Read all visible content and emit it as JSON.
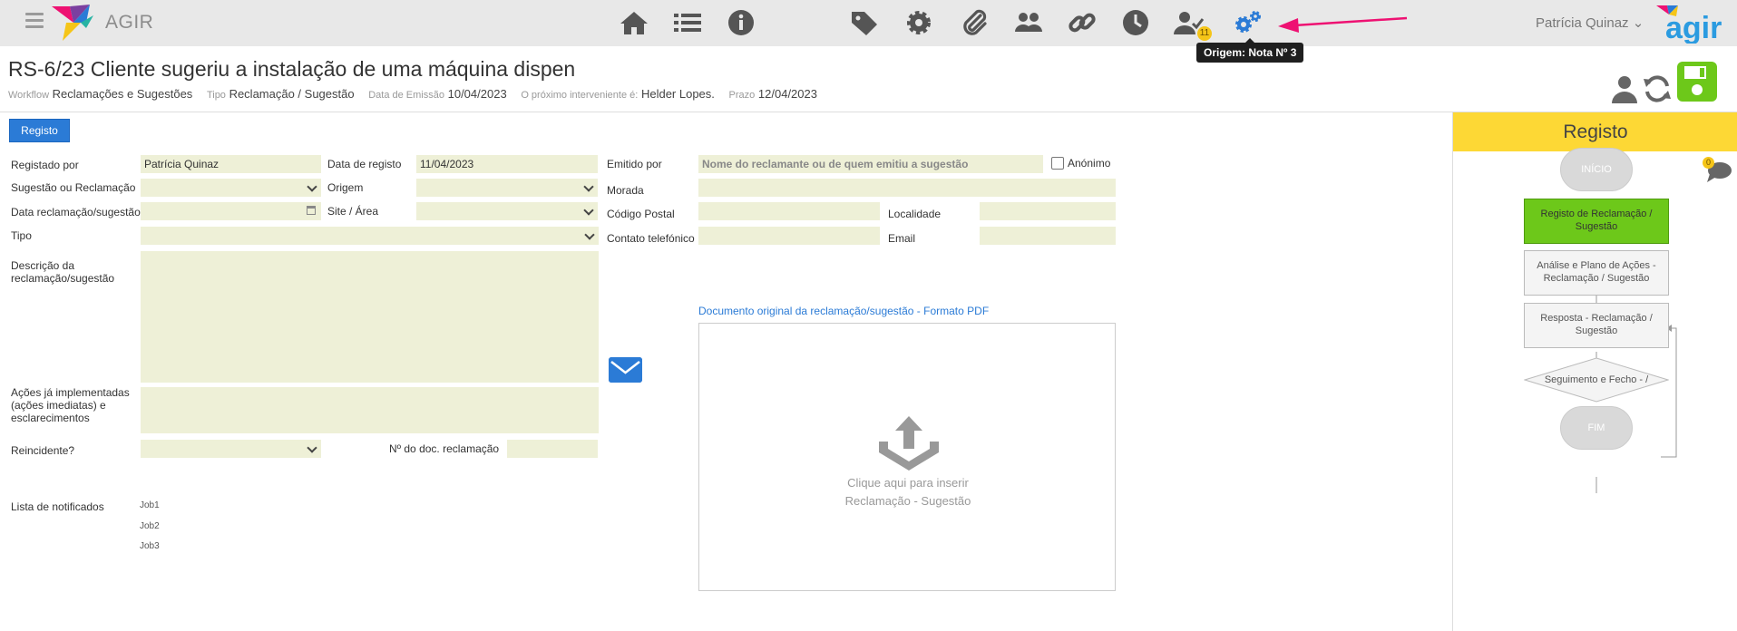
{
  "app": {
    "name": "AGIR",
    "brand_right": "agir"
  },
  "toolbar": {
    "icons": [
      "home-icon",
      "list-icon",
      "info-icon",
      "tags-icon",
      "gear-icon",
      "paperclip-icon",
      "users-icon",
      "link-icon",
      "clock-icon",
      "user-check-icon",
      "gears-icon"
    ],
    "badge": "11",
    "tooltip": "Origem: Nota Nº 3",
    "active_color": "#2b7bd6",
    "arrow_color": "#ee1172"
  },
  "user": {
    "name": "Patrícia Quinaz"
  },
  "header": {
    "title": "RS-6/23 Cliente sugeriu a instalação de uma máquina dispen",
    "meta": [
      {
        "key": "Workflow",
        "value": "Reclamações e Sugestões"
      },
      {
        "key": "Tipo",
        "value": "Reclamação / Sugestão"
      },
      {
        "key": "Data de Emissão",
        "value": "10/04/2023"
      },
      {
        "key": "O próximo interveniente é:",
        "value": "Helder Lopes."
      },
      {
        "key": "Prazo",
        "value": "12/04/2023"
      }
    ]
  },
  "tab": {
    "label": "Registo"
  },
  "form": {
    "registado_por": {
      "label": "Registado por",
      "value": "Patrícia Quinaz"
    },
    "data_registo": {
      "label": "Data de registo",
      "value": "11/04/2023"
    },
    "emitido_por": {
      "label": "Emitido por",
      "placeholder": "Nome do reclamante ou de quem emitiu a sugestão"
    },
    "anonimo": {
      "label": "Anónimo"
    },
    "sugestao_reclamacao": {
      "label": "Sugestão ou Reclamação"
    },
    "origem": {
      "label": "Origem"
    },
    "morada": {
      "label": "Morada"
    },
    "data_reclamacao": {
      "label": "Data reclamação/sugestão"
    },
    "site_area": {
      "label": "Site / Área"
    },
    "codigo_postal": {
      "label": "Código Postal"
    },
    "localidade": {
      "label": "Localidade"
    },
    "tipo": {
      "label": "Tipo"
    },
    "contato": {
      "label": "Contato telefónico"
    },
    "email": {
      "label": "Email"
    },
    "descricao": {
      "label": "Descrição da reclamação/sugestão"
    },
    "acoes": {
      "label": "Ações já implementadas (ações imediatas) e esclarecimentos"
    },
    "reincidente": {
      "label": "Reincidente?"
    },
    "num_doc": {
      "label": "Nº do doc. reclamação"
    },
    "notificados": {
      "label": "Lista de notificados",
      "jobs": [
        "Job1",
        "Job2",
        "Job3"
      ]
    },
    "pdf_link": "Documento original da reclamação/sugestão - Formato PDF",
    "upload_line1": "Clique aqui para inserir",
    "upload_line2": "Reclamação - Sugestão",
    "field_color": "#eef0d7"
  },
  "panel": {
    "title": "Registo",
    "chat_badge": "0",
    "flow": {
      "start": "INÍCIO",
      "step1": "Registo de Reclamação / Sugestão",
      "step2": "Análise e Plano de Ações - Reclamação / Sugestão",
      "step3": "Resposta - Reclamação / Sugestão",
      "step4": "Seguimento e Fecho - /",
      "end": "FIM"
    },
    "header_color": "#fdd835",
    "active_color": "#6dc81a"
  }
}
